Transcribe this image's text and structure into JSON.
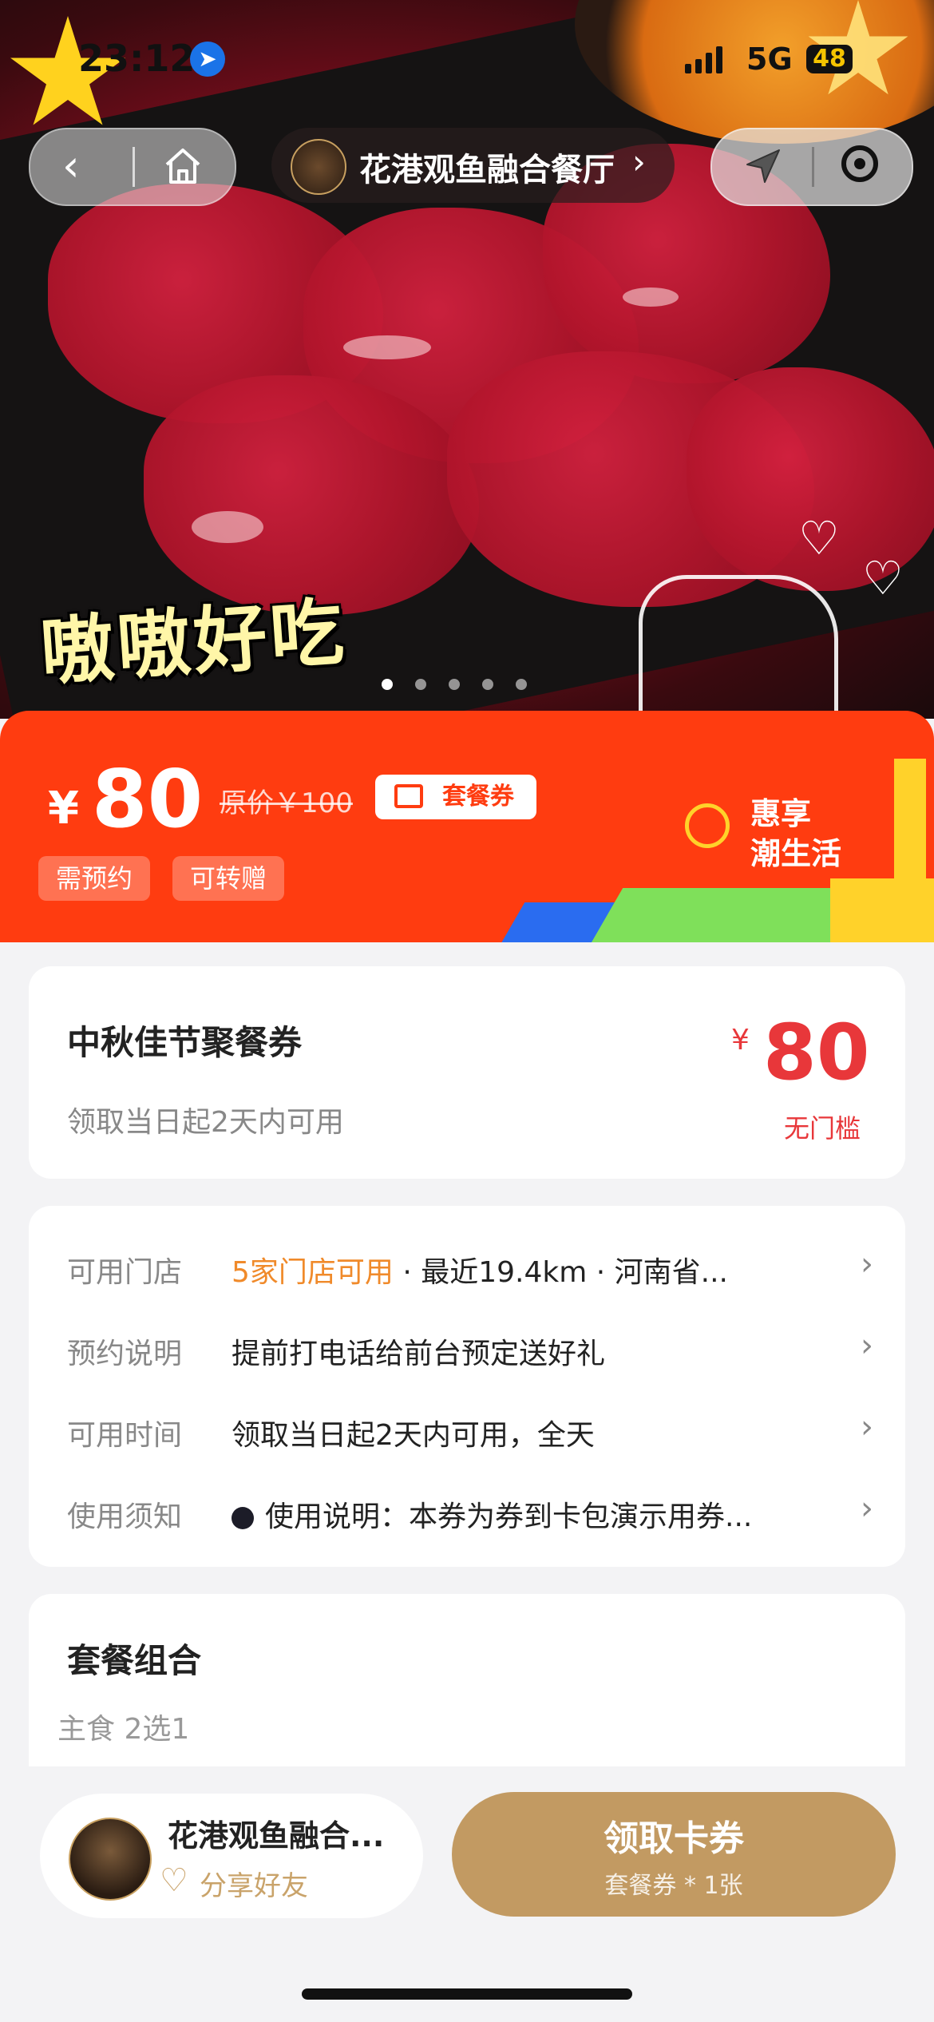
{
  "status": {
    "time": "23:12",
    "network": "5G",
    "battery": "48"
  },
  "nav": {
    "shop_name": "花港观鱼融合餐厅"
  },
  "hero": {
    "caption": "嗷嗷好吃",
    "page_count": 5,
    "active_index": 0
  },
  "banner": {
    "currency": "¥",
    "price": "80",
    "original_price": "原价￥100",
    "type_tag": "套餐券",
    "chips": [
      "需预约",
      "可转赠"
    ],
    "slogan_line1": "惠享",
    "slogan_line2": "潮生活"
  },
  "coupon": {
    "title": "中秋佳节聚餐券",
    "validity": "领取当日起2天内可用",
    "currency": "¥",
    "amount": "80",
    "threshold": "无门槛"
  },
  "details": [
    {
      "label": "可用门店",
      "highlight": "5家门店可用",
      "value": " · 最近19.4km · 河南省..."
    },
    {
      "label": "预约说明",
      "value": "提前打电话给前台预定送好礼"
    },
    {
      "label": "可用时间",
      "value": "领取当日起2天内可用，全天"
    },
    {
      "label": "使用须知",
      "value": "使用说明：本券为券到卡包演示用券..."
    }
  ],
  "package": {
    "title": "套餐组合",
    "sub": "主食  2选1"
  },
  "bottom": {
    "shop_name": "花港观鱼融合...",
    "share": "分享好友",
    "cta": "领取卡券",
    "cta_sub": "套餐券 * 1张"
  },
  "colors": {
    "banner": "#ff3c10",
    "accent_red": "#e8373a",
    "cta": "#c29a62",
    "highlight": "#f08a2a"
  }
}
